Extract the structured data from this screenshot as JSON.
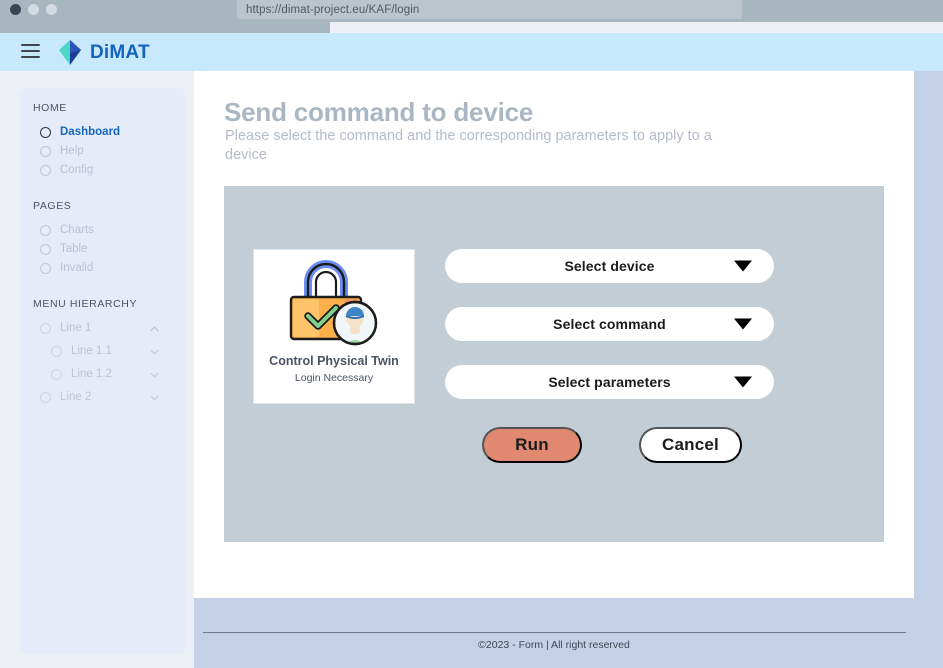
{
  "browser": {
    "url": "https://dimat-project.eu/KAF/login",
    "dots": [
      "window-close-dot",
      "window-minimize-dot",
      "window-maximize-dot"
    ]
  },
  "header": {
    "menu_icon": "hamburger-icon",
    "brand": "DiMAT",
    "brand_colors": {
      "logo_left": "#4ad6c8",
      "logo_right": "#1b3f97",
      "text": "#1565c0"
    },
    "background": "#c8e8fc"
  },
  "sidebar": {
    "background": "#e5ebf9",
    "groups": [
      {
        "title": "HOME",
        "items": [
          {
            "label": "Dashboard",
            "active": true,
            "chevron": ""
          },
          {
            "label": "Help",
            "active": false,
            "chevron": ""
          },
          {
            "label": "Config",
            "active": false,
            "chevron": ""
          }
        ]
      },
      {
        "title": "PAGES",
        "items": [
          {
            "label": "Charts",
            "active": false,
            "chevron": ""
          },
          {
            "label": "Table",
            "active": false,
            "chevron": ""
          },
          {
            "label": "Invalid",
            "active": false,
            "chevron": ""
          }
        ]
      },
      {
        "title": "MENU HIERARCHY",
        "items": [
          {
            "label": "Line 1",
            "active": false,
            "chevron": "chevron-up",
            "level": 1
          },
          {
            "label": "Line 1.1",
            "active": false,
            "chevron": "chevron-down",
            "level": 2
          },
          {
            "label": "Line 1.2",
            "active": false,
            "chevron": "chevron-down",
            "level": 2
          },
          {
            "label": "Line 2",
            "active": false,
            "chevron": "chevron-down",
            "level": 1
          }
        ]
      }
    ]
  },
  "main": {
    "title": "Send command to device",
    "subtitle": "Please select the command and the corresponding parameters to apply to a device",
    "panel_background": "#c2cdd5",
    "card": {
      "icon": "padlock-check-user-icon",
      "title": "Control Physical Twin",
      "subtitle": "Login Necessary",
      "icon_colors": {
        "body": "#fbb04c",
        "body_light": "#ffd08a",
        "shackle": "#6b8cf0",
        "check": "#7fd18a",
        "avatar_cap": "#3f86c9",
        "avatar_face": "#f6e2c8",
        "avatar_shirt": "#9ed6a0"
      }
    },
    "selects": [
      {
        "label": "Select device",
        "icon": "chevron-down-icon"
      },
      {
        "label": "Select command",
        "icon": "chevron-down-icon"
      },
      {
        "label": "Select parameters",
        "icon": "chevron-down-icon"
      }
    ],
    "buttons": {
      "run": {
        "label": "Run",
        "color": "#e08870"
      },
      "cancel": {
        "label": "Cancel",
        "color": "#ffffff"
      }
    }
  },
  "footer": {
    "text": "©2023 - Form  |   All right reserved",
    "background": "#c4d0e8"
  }
}
